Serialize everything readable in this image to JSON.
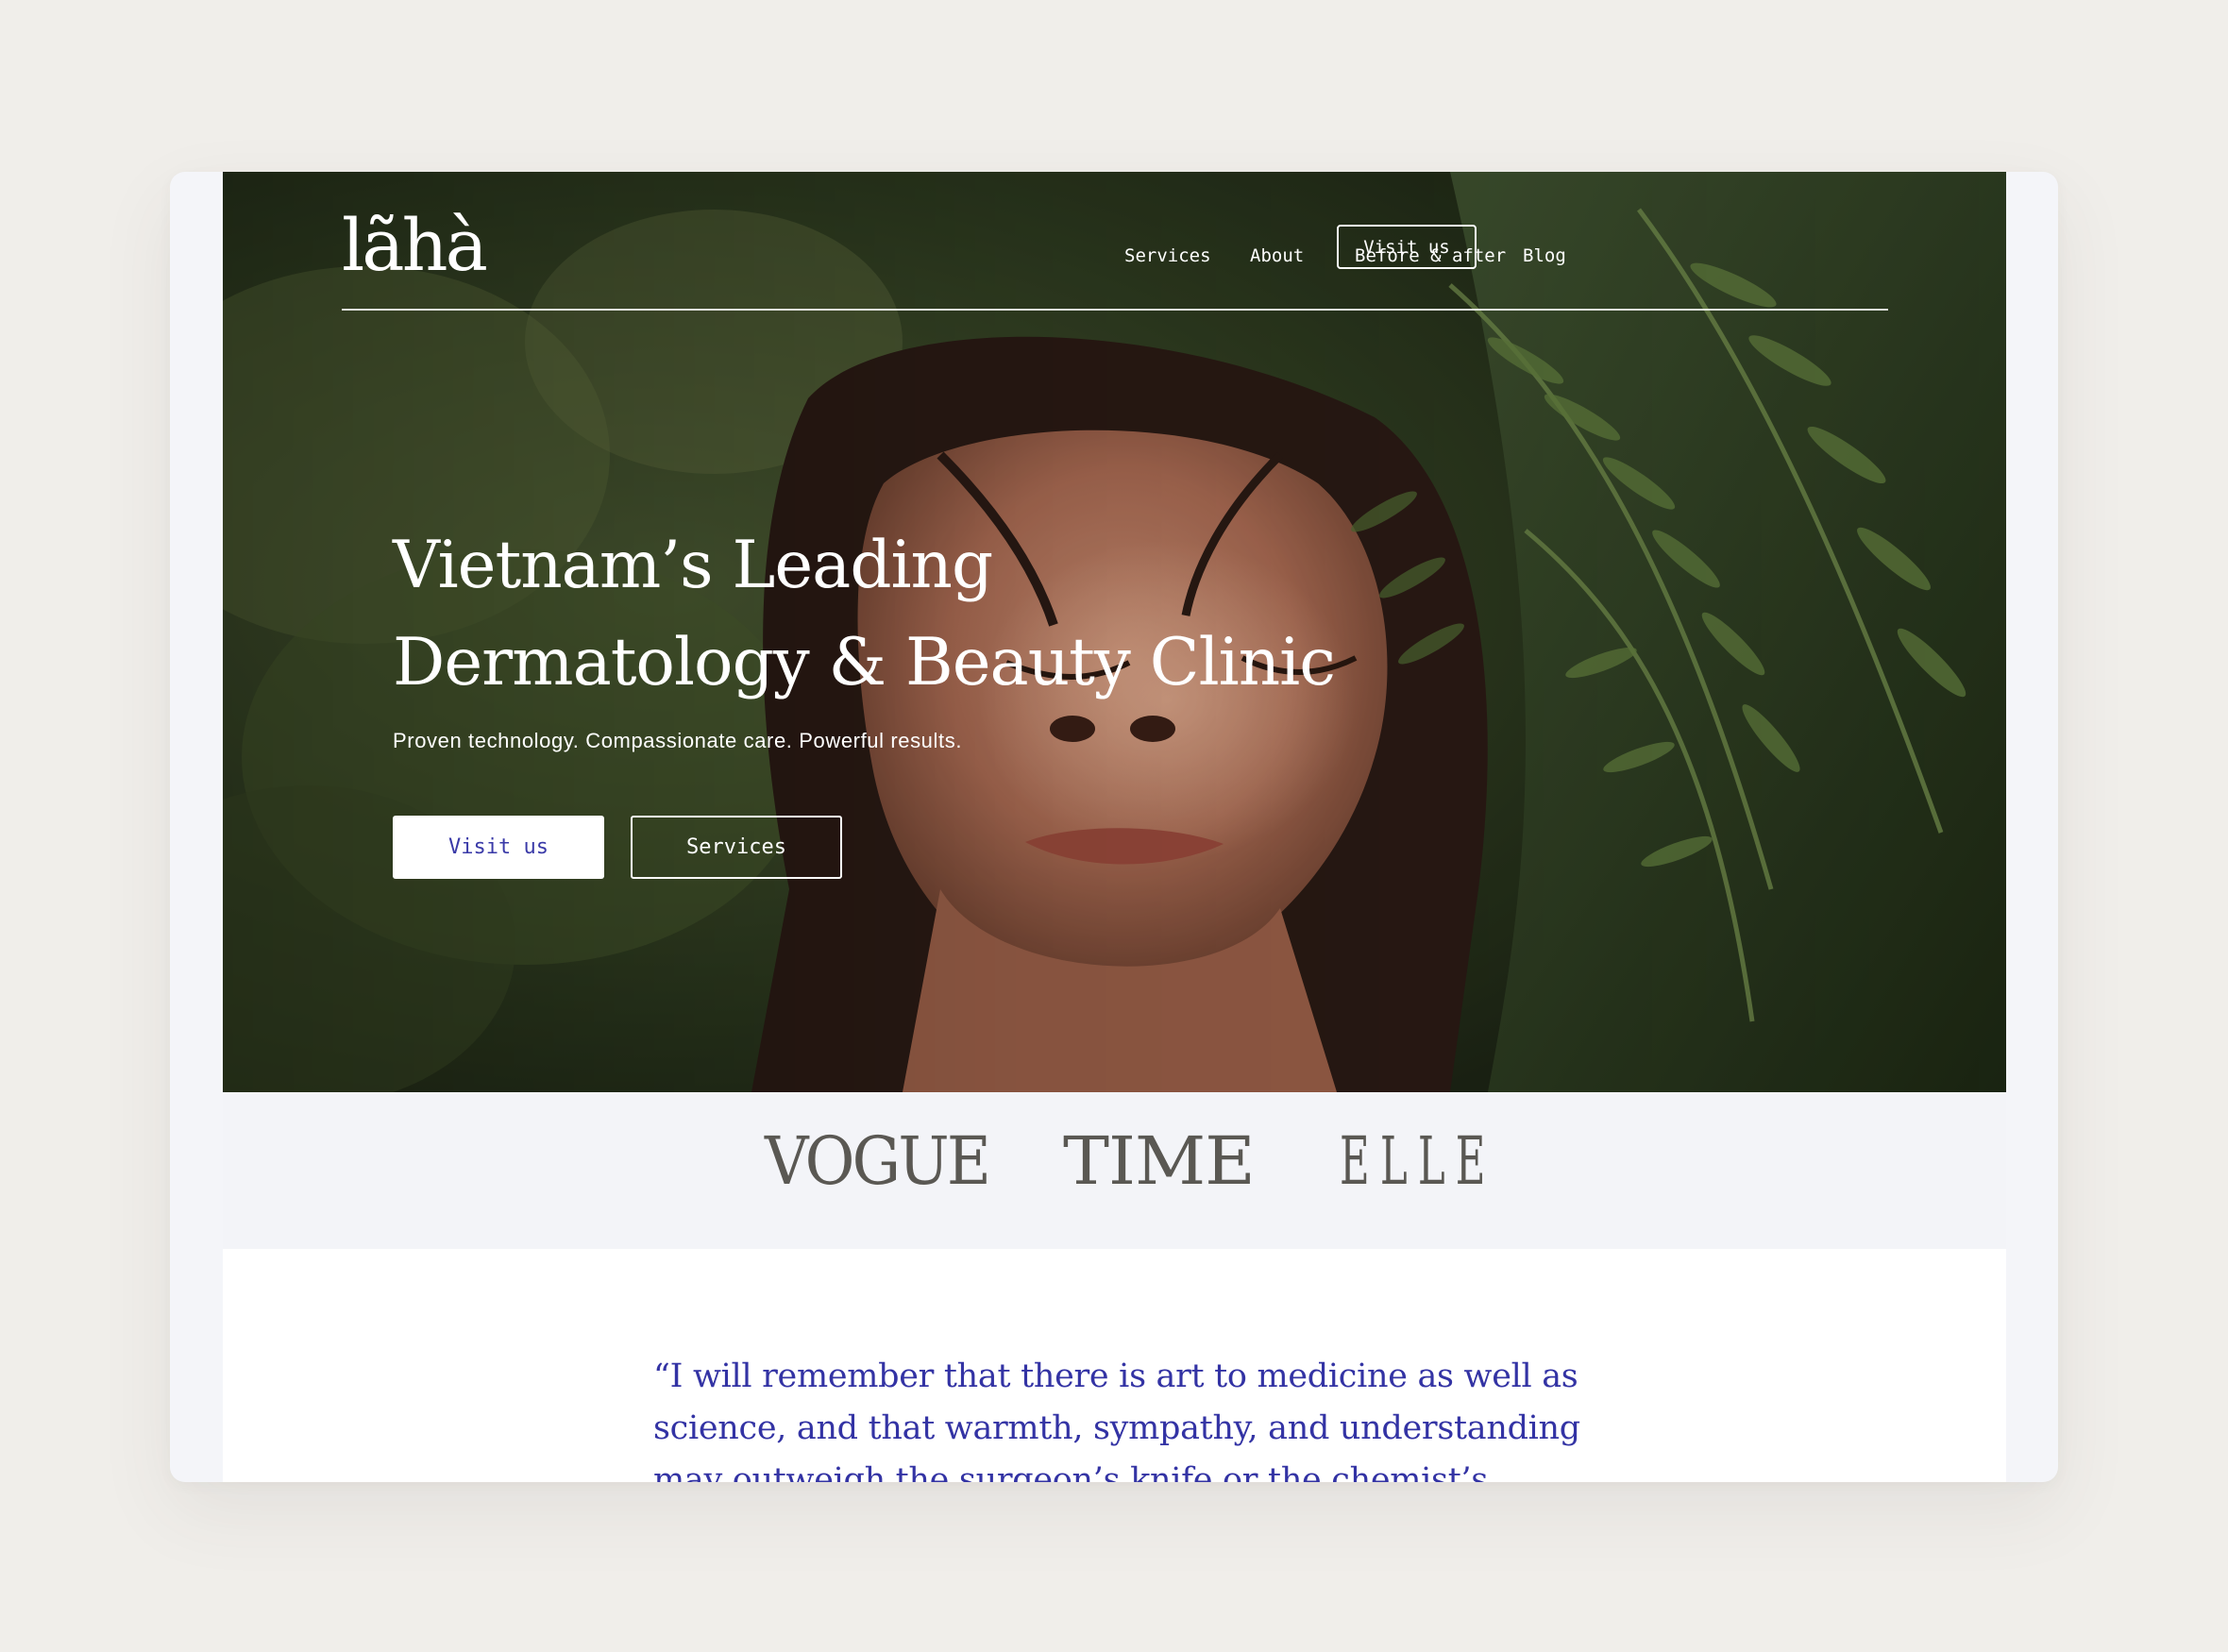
{
  "brand": {
    "logo_text": "lãhà"
  },
  "nav": {
    "links": [
      "Services",
      "About",
      "Before & after",
      "Blog"
    ],
    "cta_label": "Visit us"
  },
  "hero": {
    "title_line1": "Vietnam’s Leading",
    "title_line2": "Dermatology & Beauty Clinic",
    "subtitle": "Proven technology. Compassionate care. Powerful results.",
    "primary_button": "Visit us",
    "secondary_button": "Services",
    "image_description": "woman-face-in-ferns-photo"
  },
  "press": {
    "logos": [
      "VOGUE",
      "TIME",
      "ELLE"
    ]
  },
  "quote": {
    "text": "“I will remember that there is art to medicine as well as science, and that warmth, sympathy, and understanding may outweigh the surgeon’s knife or the chemist’s drug.”"
  },
  "colors": {
    "accent": "#3a3aa8",
    "page_bg": "#f0eeea",
    "press_text": "#5a5853"
  }
}
